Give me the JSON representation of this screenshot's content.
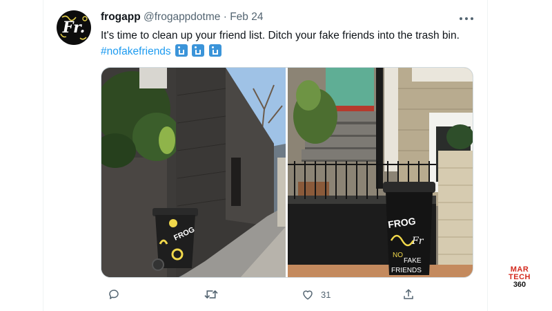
{
  "tweet": {
    "display_name": "frogapp",
    "handle": "@frogappdotme",
    "separator": "·",
    "date": "Feb 24",
    "text": "It's time to clean up your friend list. Ditch your fake friends into the trash bin.",
    "hashtag": "#nofakefriends",
    "emoji_count": 3
  },
  "avatar": {
    "text": "Fr."
  },
  "media": {
    "left_bin_text": "FROG",
    "right_bin_text_1": "FROG",
    "right_bin_text_2": "Fr",
    "right_bin_text_3": "NO",
    "right_bin_text_4": "FAKE",
    "right_bin_text_5": "FRIENDS"
  },
  "actions": {
    "reply_icon": "reply-icon",
    "retweet_icon": "retweet-icon",
    "like_icon": "heart-icon",
    "like_count": "31",
    "share_icon": "share-icon"
  },
  "watermark": {
    "line1": "MAR",
    "line2": "TECH",
    "line3": "360"
  },
  "colors": {
    "link": "#1d9bf0",
    "muted": "#536471",
    "brand_red": "#d32a1e"
  }
}
